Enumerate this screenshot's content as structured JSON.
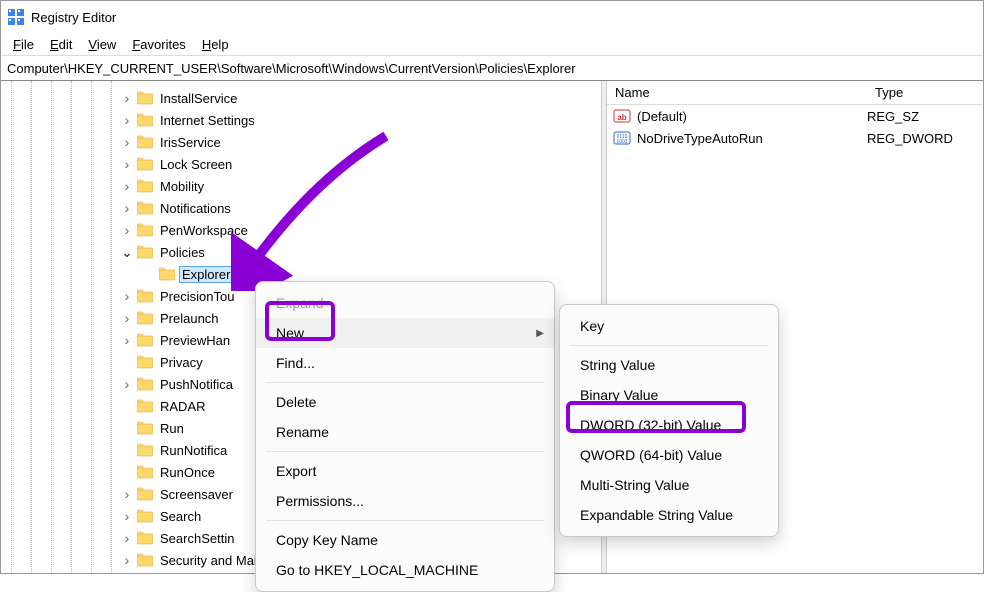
{
  "window": {
    "title": "Registry Editor"
  },
  "menubar": {
    "file": "File",
    "file_u": "F",
    "edit": "Edit",
    "edit_u": "E",
    "view": "View",
    "view_u": "V",
    "favorites": "Favorites",
    "favorites_u": "F",
    "help": "Help",
    "help_u": "H"
  },
  "addressbar": {
    "path": "Computer\\HKEY_CURRENT_USER\\Software\\Microsoft\\Windows\\CurrentVersion\\Policies\\Explorer"
  },
  "tree": {
    "items": [
      {
        "label": "InstallService",
        "expander": ">"
      },
      {
        "label": "Internet Settings",
        "expander": ">"
      },
      {
        "label": "IrisService",
        "expander": ">"
      },
      {
        "label": "Lock Screen",
        "expander": ">"
      },
      {
        "label": "Mobility",
        "expander": ">"
      },
      {
        "label": "Notifications",
        "expander": ">"
      },
      {
        "label": "PenWorkspace",
        "expander": ">"
      },
      {
        "label": "Policies",
        "expander": "v",
        "expanded": true
      },
      {
        "label": "Explorer",
        "expander": "",
        "child": true,
        "selected": true
      },
      {
        "label": "PrecisionTou",
        "expander": ">"
      },
      {
        "label": "Prelaunch",
        "expander": ">"
      },
      {
        "label": "PreviewHan",
        "expander": ">"
      },
      {
        "label": "Privacy",
        "expander": ""
      },
      {
        "label": "PushNotifica",
        "expander": ">"
      },
      {
        "label": "RADAR",
        "expander": ""
      },
      {
        "label": "Run",
        "expander": ""
      },
      {
        "label": "RunNotifica",
        "expander": ""
      },
      {
        "label": "RunOnce",
        "expander": ""
      },
      {
        "label": "Screensaver",
        "expander": ">"
      },
      {
        "label": "Search",
        "expander": ">"
      },
      {
        "label": "SearchSettin",
        "expander": ">"
      },
      {
        "label": "Security and Maintenance",
        "expander": ">"
      }
    ]
  },
  "list": {
    "columns": {
      "name": "Name",
      "type": "Type"
    },
    "rows": [
      {
        "icon": "string",
        "name": "(Default)",
        "type": "REG_SZ"
      },
      {
        "icon": "dword",
        "name": "NoDriveTypeAutoRun",
        "type": "REG_DWORD"
      }
    ]
  },
  "context_menu_main": {
    "expand": "Expand",
    "new": "New",
    "find": "Find...",
    "delete": "Delete",
    "rename": "Rename",
    "export": "Export",
    "permissions": "Permissions...",
    "copy_key": "Copy Key Name",
    "goto": "Go to HKEY_LOCAL_MACHINE"
  },
  "context_menu_new": {
    "key": "Key",
    "string": "String Value",
    "binary": "Binary Value",
    "dword": "DWORD (32-bit) Value",
    "qword": "QWORD (64-bit) Value",
    "multi": "Multi-String Value",
    "expandable": "Expandable String Value"
  }
}
